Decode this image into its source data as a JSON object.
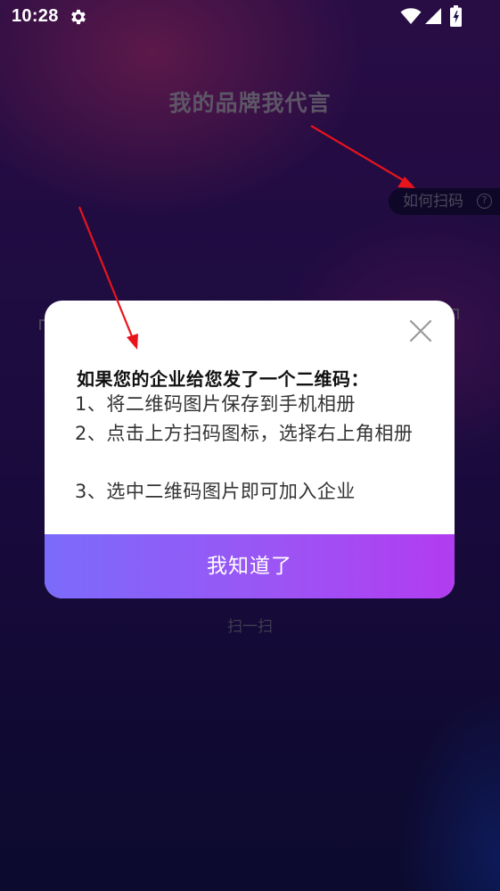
{
  "status_bar": {
    "time": "10:28",
    "icons": [
      "gear-icon",
      "wifi-icon",
      "signal-icon",
      "battery-charging-icon"
    ]
  },
  "page": {
    "title": "我的品牌我代言",
    "how_to_scan": "如何扫码",
    "scan_label": "扫一扫"
  },
  "dialog": {
    "heading": "如果您的企业给您发了一个二维码：",
    "steps": [
      "1、将二维码图片保存到手机相册",
      "2、点击上方扫码图标，选择右上角相册",
      "3、选中二维码图片即可加入企业"
    ],
    "confirm_label": "我知道了"
  },
  "colors": {
    "button_gradient_start": "#7b6bfb",
    "button_gradient_end": "#b23cf0",
    "annotation_arrow": "#e8141c",
    "background": "#2d1260"
  }
}
